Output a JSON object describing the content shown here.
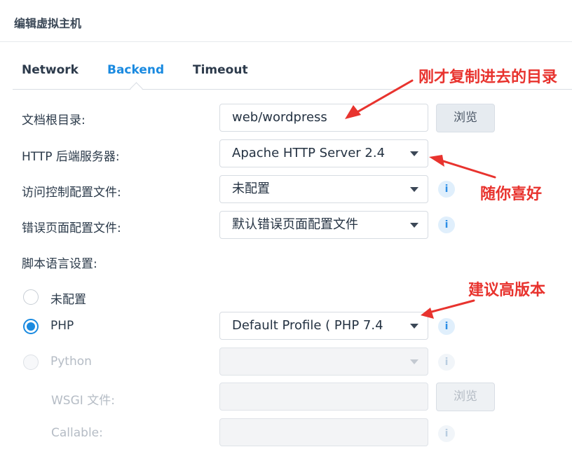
{
  "dialog": {
    "title": "编辑虚拟主机"
  },
  "tabs": [
    {
      "label": "Network",
      "active": false
    },
    {
      "label": "Backend",
      "active": true
    },
    {
      "label": "Timeout",
      "active": false
    }
  ],
  "form": {
    "doc_root": {
      "label": "文档根目录:",
      "value": "web/wordpress",
      "button": "浏览"
    },
    "http_backend": {
      "label": "HTTP 后端服务器:",
      "value": "Apache HTTP Server 2.4"
    },
    "access_control": {
      "label": "访问控制配置文件:",
      "value": "未配置"
    },
    "error_page": {
      "label": "错误页面配置文件:",
      "value": "默认错误页面配置文件"
    },
    "script_language": {
      "label": "脚本语言设置:",
      "options": [
        {
          "label": "未配置",
          "checked": false,
          "disabled": false
        },
        {
          "label": "PHP",
          "checked": true,
          "disabled": false,
          "value": "Default Profile ( PHP 7.4"
        },
        {
          "label": "Python",
          "checked": false,
          "disabled": true,
          "value": ""
        }
      ]
    },
    "wsgi_file": {
      "label": "WSGI 文件:",
      "value": "",
      "button": "浏览"
    },
    "callable": {
      "label": "Callable:",
      "value": ""
    }
  },
  "annotations": {
    "doc_root_note": "刚才复制进去的目录",
    "backend_note": "随你喜好",
    "php_note": "建议高版本"
  },
  "colors": {
    "accent": "#1a8ae0",
    "annotation": "#e8332e"
  },
  "icons": {
    "info": "info-icon",
    "dropdown": "chevron-down-icon"
  }
}
